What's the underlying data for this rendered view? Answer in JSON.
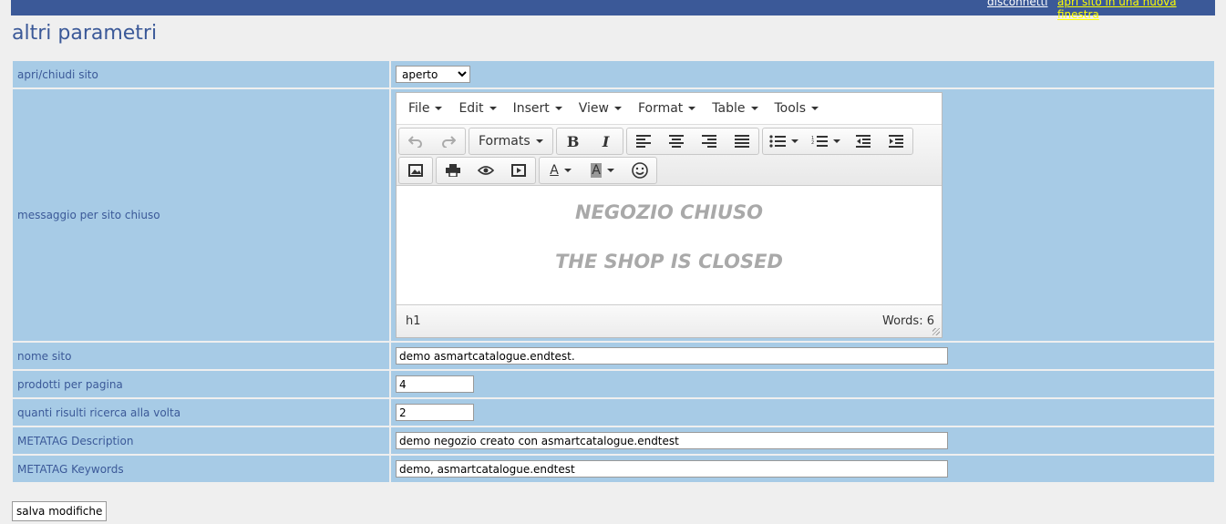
{
  "header": {
    "disconnect_label": "disconnetti",
    "new_window_label": "apri sito in una nuova finestra",
    "bar_color": "#3b5998"
  },
  "page": {
    "title": "altri parametri"
  },
  "form": {
    "open_close": {
      "label": "apri/chiudi sito",
      "selected": "aperto"
    },
    "closed_message": {
      "label": "messaggio per sito chiuso",
      "editor": {
        "menu": [
          "File",
          "Edit",
          "Insert",
          "View",
          "Format",
          "Table",
          "Tools"
        ],
        "formats_label": "Formats",
        "content_lines": [
          "NEGOZIO CHIUSO",
          "THE SHOP IS CLOSED"
        ],
        "status_path": "h1",
        "word_count": "Words: 6"
      }
    },
    "site_name": {
      "label": "nome sito",
      "value": "demo asmartcatalogue.endtest."
    },
    "products_per_page": {
      "label": "prodotti per pagina",
      "value": "4"
    },
    "search_results": {
      "label": "quanti risulti ricerca alla volta",
      "value": "2"
    },
    "meta_description": {
      "label": "METATAG Description",
      "value": "demo negozio creato con asmartcatalogue.endtest"
    },
    "meta_keywords": {
      "label": "METATAG Keywords",
      "value": "demo, asmartcatalogue.endtest"
    }
  },
  "save_label": "salva modifiche"
}
